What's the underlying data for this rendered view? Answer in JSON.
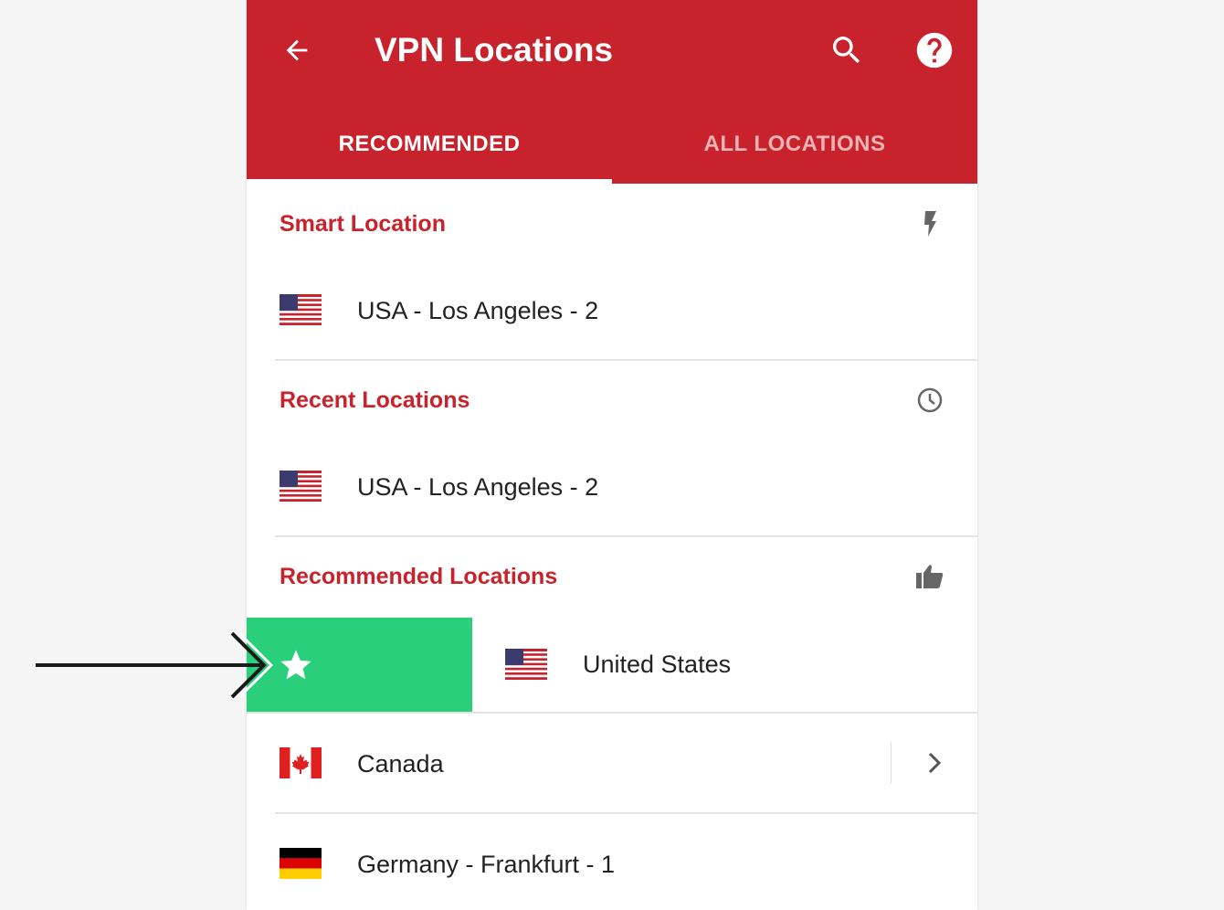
{
  "header": {
    "title": "VPN Locations",
    "back_icon": "arrow-back-icon",
    "search_icon": "search-icon",
    "help_icon": "help-circle-icon",
    "background_color": "#c8232c"
  },
  "tabs": [
    {
      "label": "RECOMMENDED",
      "active": true
    },
    {
      "label": "ALL LOCATIONS",
      "active": false
    }
  ],
  "sections": {
    "smart": {
      "title": "Smart Location",
      "icon": "lightning-bolt-icon",
      "items": [
        {
          "label": "USA - Los Angeles - 2",
          "flag": "us-flag-icon"
        }
      ]
    },
    "recent": {
      "title": "Recent Locations",
      "icon": "clock-icon",
      "items": [
        {
          "label": "USA - Los Angeles - 2",
          "flag": "us-flag-icon"
        }
      ]
    },
    "recommended": {
      "title": "Recommended Locations",
      "icon": "thumbs-up-icon",
      "items": [
        {
          "label": "United States",
          "flag": "us-flag-icon",
          "swiped": true,
          "swipe_action_icon": "star-icon",
          "swipe_action_color": "#29cf7a"
        },
        {
          "label": "Canada",
          "flag": "canada-flag-icon",
          "expandable": true,
          "expand_icon": "chevron-right-icon"
        },
        {
          "label": "Germany - Frankfurt - 1",
          "flag": "germany-flag-icon"
        }
      ]
    }
  },
  "colors": {
    "accent": "#c8232c",
    "favorite": "#29cf7a",
    "text": "#222222",
    "icon_gray": "#666666"
  }
}
